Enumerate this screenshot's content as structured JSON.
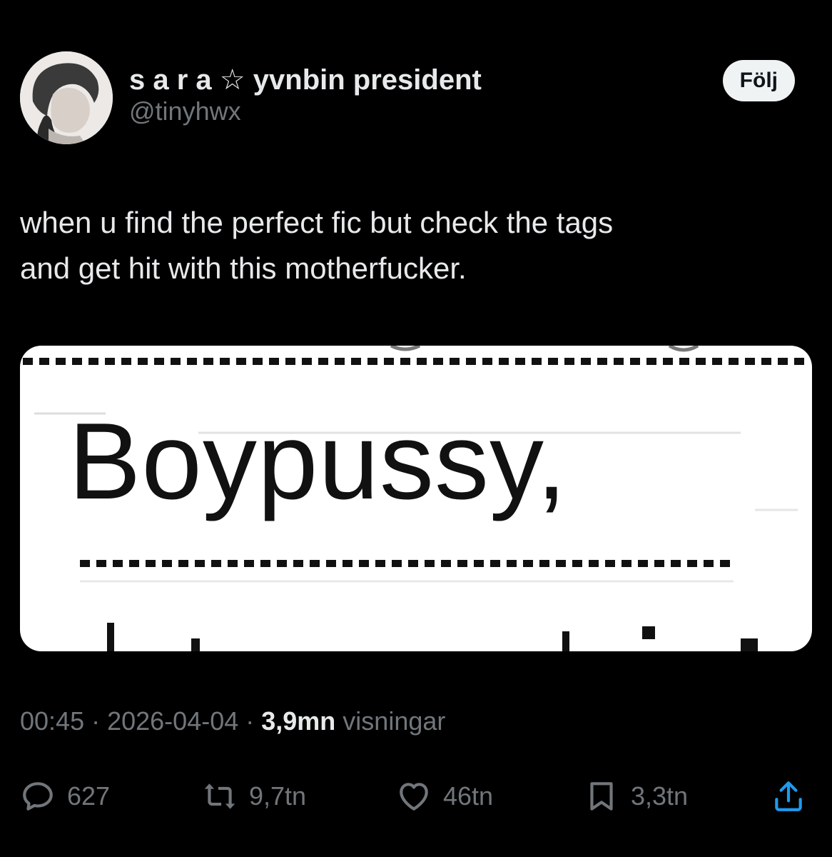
{
  "author": {
    "display_name": "s a r a",
    "star": "☆",
    "display_name_rest": "yvnbin president",
    "handle": "@tinyhwx"
  },
  "follow_label": "Följ",
  "tweet": {
    "line1": "when u find the perfect fic but check the tags",
    "line2": "and get hit with this motherfucker."
  },
  "media": {
    "word": "Boypussy,"
  },
  "meta": {
    "time": "00:45",
    "sep1": " · ",
    "date": "2026-04-04",
    "sep2": " · ",
    "views_count": "3,9mn",
    "views_label": " visningar"
  },
  "actions": {
    "replies": "627",
    "reposts": "9,7tn",
    "likes": "46tn",
    "bookmarks": "3,3tn"
  },
  "icons": [
    "reply-icon",
    "repost-icon",
    "like-icon",
    "bookmark-icon",
    "share-icon"
  ],
  "colors": {
    "background": "#000000",
    "text": "#e7e9ea",
    "secondary": "#71767b",
    "follow_bg": "#eff3f4"
  }
}
